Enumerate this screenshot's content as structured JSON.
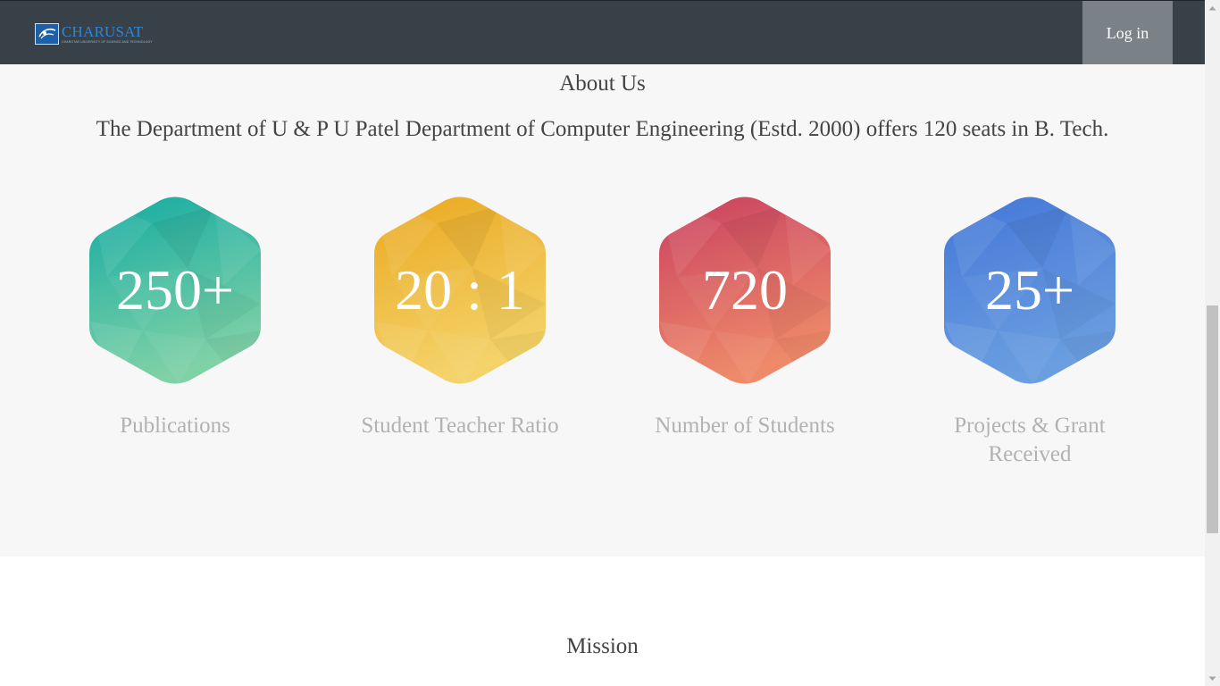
{
  "navbar": {
    "logo_text": "CHARUSAT",
    "logo_subtext": "CHAROTAR UNIVERSITY OF SCIENCE AND TECHNOLOGY",
    "login_label": "Log in",
    "background_color": "#374147"
  },
  "about": {
    "title": "About Us",
    "description": "The Department of U & P U Patel Department of Computer Engineering (Estd. 2000) offers 120 seats in B. Tech.",
    "stats": [
      {
        "value": "250+",
        "label": "Publications",
        "color_top": "#14aba2",
        "color_bottom": "#7fd1a6"
      },
      {
        "value": "20 : 1",
        "label": "Student Teacher Ratio",
        "color_top": "#eaa820",
        "color_bottom": "#f4d36a"
      },
      {
        "value": "720",
        "label": "Number of Students",
        "color_top": "#c9405f",
        "color_bottom": "#ee8a6a"
      },
      {
        "value": "25+",
        "label": "Projects & Grant Received",
        "color_top": "#4477d8",
        "color_bottom": "#6a9ee0"
      }
    ]
  },
  "mission": {
    "title": "Mission"
  },
  "icons": {
    "logo": "university-emblem-icon",
    "scroll_up": "chevron-up-icon",
    "scroll_down": "chevron-down-icon"
  }
}
